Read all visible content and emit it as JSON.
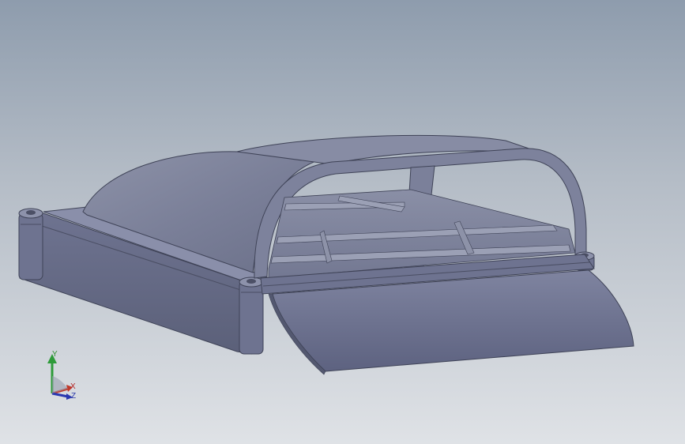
{
  "viewport": {
    "background_top": "#8e9cad",
    "background_bottom": "#dfe2e6",
    "model_color": "#6b6f86"
  },
  "triad": {
    "x_label": "X",
    "y_label": "Y",
    "z_label": "Z",
    "x_color": "#c0392b",
    "y_color": "#2e9b3a",
    "z_color": "#2a38b0"
  }
}
